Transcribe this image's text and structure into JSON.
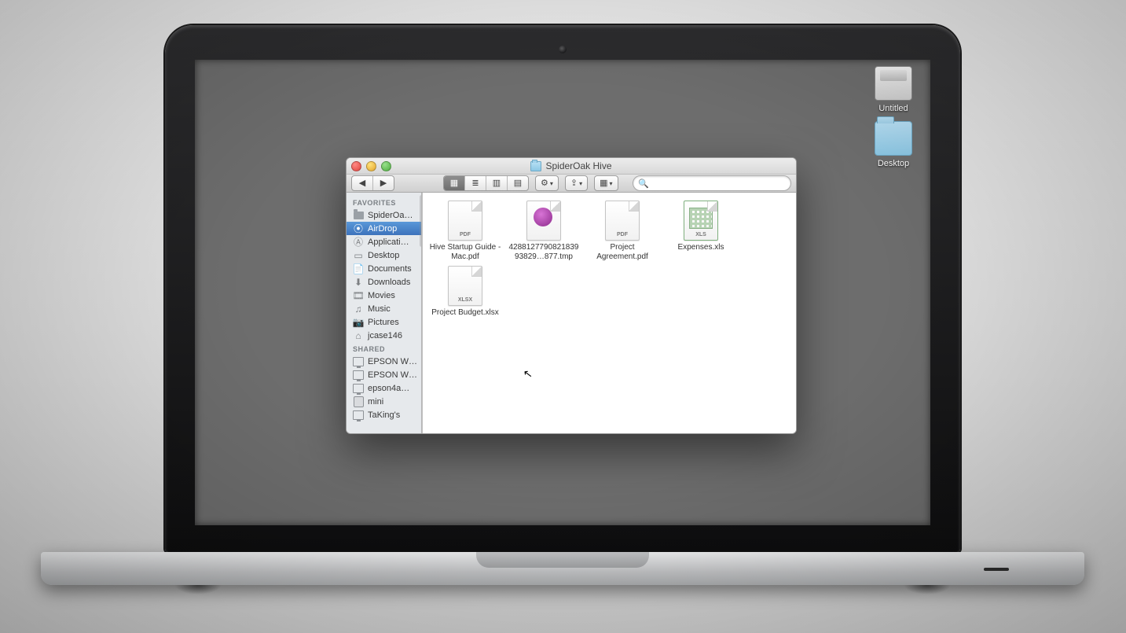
{
  "desktop": {
    "items": [
      {
        "name": "Untitled",
        "kind": "hd"
      },
      {
        "name": "Desktop",
        "kind": "folder"
      }
    ]
  },
  "finder": {
    "window_title": "SpiderOak Hive",
    "toolbar": {
      "nav_back": "◀",
      "nav_fwd": "▶",
      "view_icon": "icon-grid",
      "view_list": "icon-list",
      "view_column": "icon-columns",
      "view_cover": "icon-coverflow",
      "action_gear": "⚙",
      "dropbox": "⇪",
      "arrange": "≣",
      "search_placeholder": ""
    },
    "sidebar": {
      "favorites_heading": "FAVORITES",
      "favorites": [
        {
          "label": "SpiderOa…",
          "icon": "folder",
          "selected": false
        },
        {
          "label": "AirDrop",
          "icon": "airdrop",
          "selected": true
        },
        {
          "label": "Applicati…",
          "icon": "apps",
          "selected": false
        },
        {
          "label": "Desktop",
          "icon": "desktop",
          "selected": false
        },
        {
          "label": "Documents",
          "icon": "documents",
          "selected": false
        },
        {
          "label": "Downloads",
          "icon": "downloads",
          "selected": false
        },
        {
          "label": "Movies",
          "icon": "movies",
          "selected": false
        },
        {
          "label": "Music",
          "icon": "music",
          "selected": false
        },
        {
          "label": "Pictures",
          "icon": "pictures",
          "selected": false
        },
        {
          "label": "jcase146",
          "icon": "home",
          "selected": false
        }
      ],
      "shared_heading": "SHARED",
      "shared": [
        {
          "label": "EPSON W…",
          "icon": "display"
        },
        {
          "label": "EPSON W…",
          "icon": "display"
        },
        {
          "label": "epson4a…",
          "icon": "display"
        },
        {
          "label": "mini",
          "icon": "hd"
        },
        {
          "label": "TaKing's",
          "icon": "display"
        }
      ]
    },
    "files": [
      {
        "name": "Hive Startup Guide - Mac.pdf",
        "tag": "PDF",
        "kind": "pdf"
      },
      {
        "name": "428812779082183993829…877.tmp",
        "tag": "",
        "kind": "tmp"
      },
      {
        "name": "Project Agreement.pdf",
        "tag": "PDF",
        "kind": "pdf"
      },
      {
        "name": "Expenses.xls",
        "tag": "XLS",
        "kind": "xls"
      },
      {
        "name": "Project Budget.xlsx",
        "tag": "XLSX",
        "kind": "xlsx"
      }
    ]
  }
}
